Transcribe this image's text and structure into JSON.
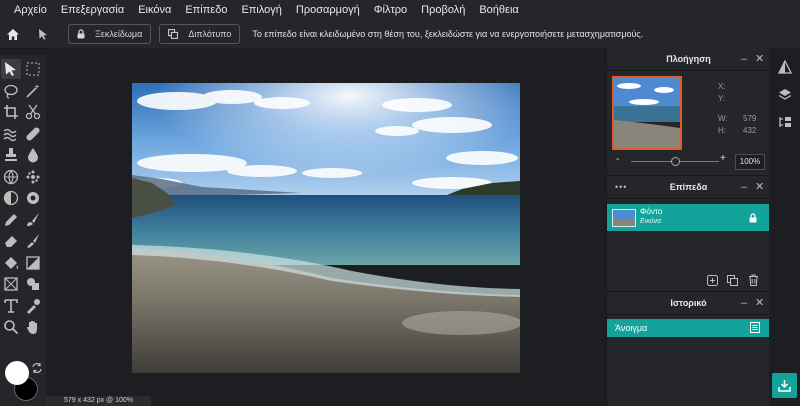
{
  "menu": [
    "Αρχείο",
    "Επεξεργασία",
    "Εικόνα",
    "Επίπεδο",
    "Επιλογή",
    "Προσαρμογή",
    "Φίλτρο",
    "Προβολή",
    "Βοήθεια"
  ],
  "toolbar": {
    "unlock_label": "Ξεκλείδωμα",
    "duplicate_label": "Διπλότυπο",
    "message": "Το επίπεδο είναι κλειδωμένο στη θέση του, ξεκλειδώστε για να ενεργοποιήσετε μετασχηματισμούς."
  },
  "navigator": {
    "title": "Πλοήγηση",
    "x_label": "X:",
    "y_label": "Y:",
    "w_label": "W:",
    "w_value": "579",
    "h_label": "H:",
    "h_value": "432",
    "zoom_minus": "-",
    "zoom_plus": "+",
    "zoom_value": "100%",
    "zoom_level": 0.5
  },
  "layers": {
    "title": "Επίπεδα",
    "menu_icon": "•••",
    "items": [
      {
        "name": "Φόντο",
        "type": "Εικόνα"
      }
    ]
  },
  "history": {
    "title": "Ιστορικό",
    "items": [
      "Άνοιγμα"
    ]
  },
  "status": {
    "text": "579 x 432 px @ 100%"
  },
  "colors": {
    "accent": "#12a39a",
    "foreground": "#ffffff",
    "background": "#000000",
    "thumb_border": "#e05a2c",
    "export_button": "#12a39a"
  },
  "icons": {
    "left_tools": [
      "move-icon",
      "marquee-icon",
      "lasso-icon",
      "magic-wand-icon",
      "crop-icon",
      "scissors-icon",
      "liquify-icon",
      "healing-icon",
      "stamp-icon",
      "drop-icon",
      "sphere-icon",
      "spot-icon",
      "dodge-icon",
      "sponge-icon",
      "pen-icon",
      "brush-icon",
      "eraser-icon",
      "paint-brush-icon",
      "fill-icon",
      "gradient-icon",
      "frame-icon",
      "shape-icon",
      "text-icon",
      "picker-icon",
      "zoom-icon",
      "hand-icon"
    ],
    "right_tools": [
      "adjust-icon",
      "layers-icon",
      "properties-icon",
      "export-icon"
    ]
  }
}
